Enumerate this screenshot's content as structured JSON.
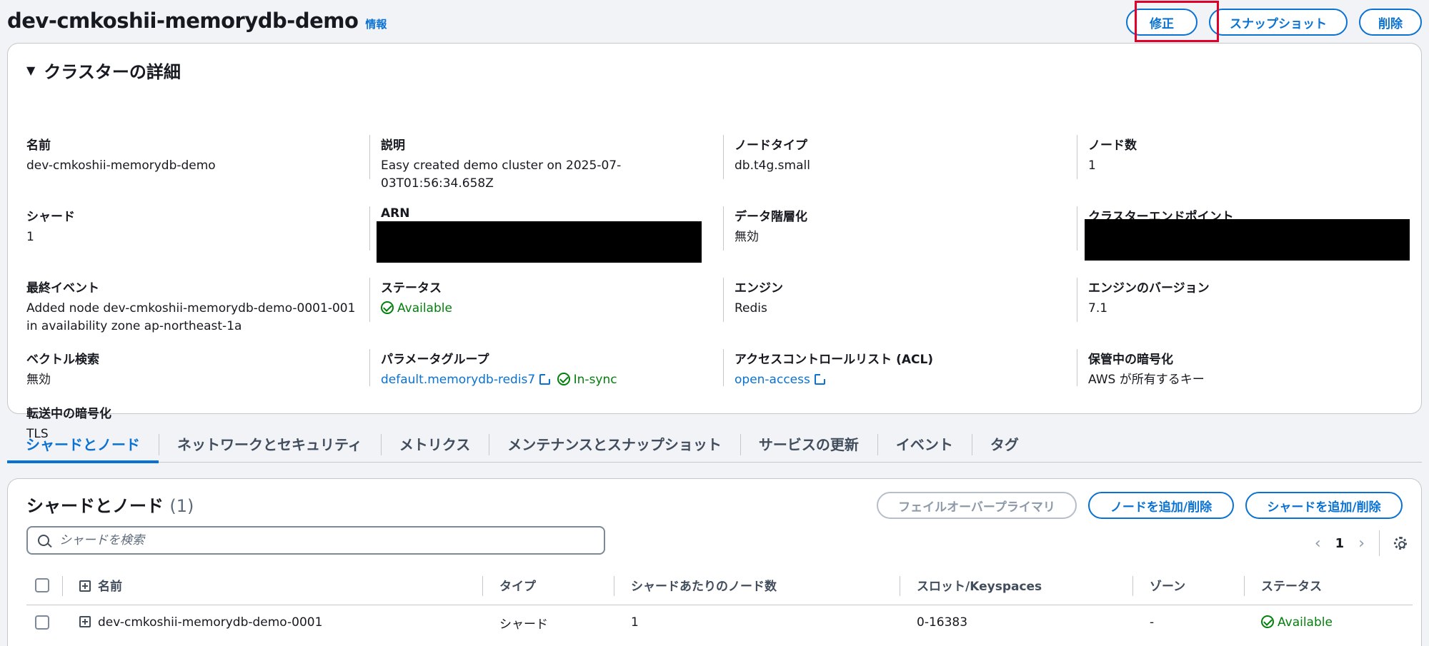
{
  "header": {
    "title": "dev-cmkoshii-memorydb-demo",
    "info": "情報",
    "actions": {
      "modify": "修正",
      "snapshot": "スナップショット",
      "delete": "削除"
    }
  },
  "details": {
    "heading": "クラスターの詳細",
    "fields": {
      "name": {
        "label": "名前",
        "value": "dev-cmkoshii-memorydb-demo"
      },
      "description": {
        "label": "説明",
        "value": "Easy created demo cluster on 2025-07-03T01:56:34.658Z"
      },
      "node_type": {
        "label": "ノードタイプ",
        "value": "db.t4g.small"
      },
      "node_count": {
        "label": "ノード数",
        "value": "1"
      },
      "shards": {
        "label": "シャード",
        "value": "1"
      },
      "arn": {
        "label": "ARN"
      },
      "data_tiering": {
        "label": "データ階層化",
        "value": "無効"
      },
      "cluster_endpoint": {
        "label": "クラスターエンドポイント"
      },
      "last_event": {
        "label": "最終イベント",
        "value": "Added node dev-cmkoshii-memorydb-demo-0001-001 in availability zone ap-northeast-1a"
      },
      "status": {
        "label": "ステータス",
        "value": "Available"
      },
      "engine": {
        "label": "エンジン",
        "value": "Redis"
      },
      "engine_version": {
        "label": "エンジンのバージョン",
        "value": "7.1"
      },
      "vector_search": {
        "label": "ベクトル検索",
        "value": "無効"
      },
      "parameter_group": {
        "label": "パラメータグループ",
        "value": "default.memorydb-redis7",
        "sync": "In-sync"
      },
      "acl": {
        "label": "アクセスコントロールリスト (ACL)",
        "value": "open-access"
      },
      "encryption_at_rest": {
        "label": "保管中の暗号化",
        "value": "AWS が所有するキー"
      },
      "encryption_in_transit": {
        "label": "転送中の暗号化",
        "value": "TLS"
      }
    }
  },
  "tabs": [
    {
      "label": "シャードとノード",
      "active": true
    },
    {
      "label": "ネットワークとセキュリティ"
    },
    {
      "label": "メトリクス"
    },
    {
      "label": "メンテナンスとスナップショット"
    },
    {
      "label": "サービスの更新"
    },
    {
      "label": "イベント"
    },
    {
      "label": "タグ"
    }
  ],
  "shards": {
    "title": "シャードとノード",
    "count": "(1)",
    "actions": {
      "failover": "フェイルオーバープライマリ",
      "add_remove_nodes": "ノードを追加/削除",
      "add_remove_shards": "シャードを追加/削除"
    },
    "search_placeholder": "シャードを検索",
    "page": "1",
    "columns": [
      "名前",
      "タイプ",
      "シャードあたりのノード数",
      "スロット/Keyspaces",
      "ゾーン",
      "ステータス"
    ],
    "rows": [
      {
        "name": "dev-cmkoshii-memorydb-demo-0001",
        "type": "シャード",
        "nodes": "1",
        "slots": "0-16383",
        "zone": "-",
        "status": "Available"
      }
    ]
  },
  "colors": {
    "link": "#0972d3",
    "success": "#037f0c",
    "highlight": "#e0002a",
    "redaction": "#000000"
  }
}
